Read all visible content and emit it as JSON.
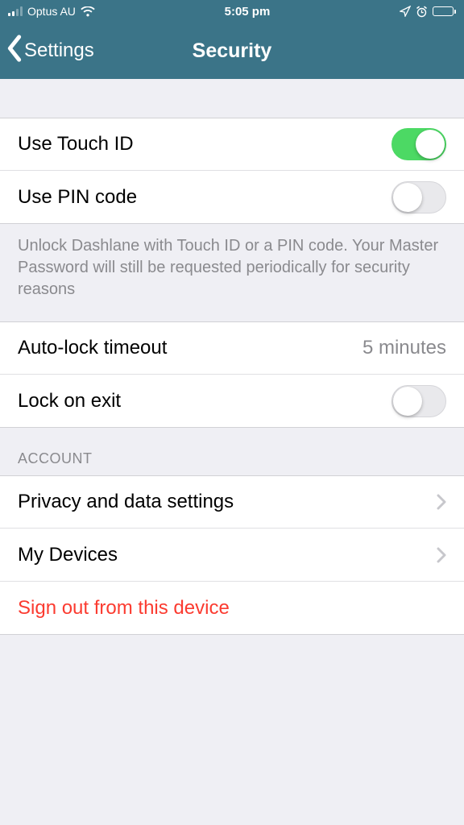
{
  "statusbar": {
    "carrier": "Optus AU",
    "time": "5:05 pm"
  },
  "nav": {
    "back_label": "Settings",
    "title": "Security"
  },
  "section1": {
    "touchid_label": "Use Touch ID",
    "touchid_on": true,
    "pincode_label": "Use PIN code",
    "pincode_on": false,
    "footer": "Unlock Dashlane with Touch ID or a PIN code. Your Master Password will still be requested periodically for security reasons"
  },
  "section2": {
    "autolock_label": "Auto-lock timeout",
    "autolock_value": "5 minutes",
    "lockexit_label": "Lock on exit",
    "lockexit_on": false
  },
  "section3": {
    "header": "ACCOUNT",
    "privacy_label": "Privacy and data settings",
    "devices_label": "My Devices",
    "signout_label": "Sign out from this device"
  }
}
